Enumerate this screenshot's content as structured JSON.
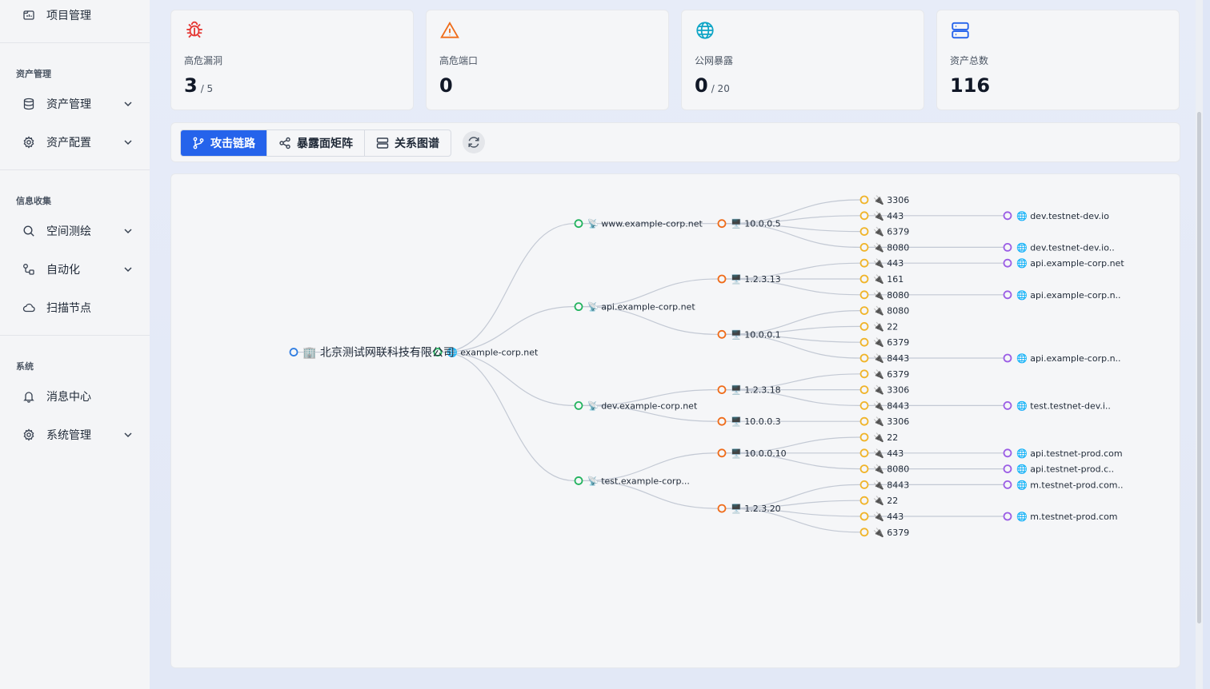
{
  "sidebar": {
    "top_item": {
      "label": "项目管理",
      "icon": "project-icon"
    },
    "sections": [
      {
        "title": "资产管理",
        "items": [
          {
            "label": "资产管理",
            "icon": "database-icon",
            "expandable": true
          },
          {
            "label": "资产配置",
            "icon": "gear-icon",
            "expandable": true
          }
        ]
      },
      {
        "title": "信息收集",
        "items": [
          {
            "label": "空间测绘",
            "icon": "search-icon",
            "expandable": true
          },
          {
            "label": "自动化",
            "icon": "workflow-icon",
            "expandable": true
          },
          {
            "label": "扫描节点",
            "icon": "cloud-icon",
            "expandable": false
          }
        ]
      },
      {
        "title": "系统",
        "items": [
          {
            "label": "消息中心",
            "icon": "bell-icon",
            "expandable": false
          },
          {
            "label": "系统管理",
            "icon": "gear-icon",
            "expandable": true
          }
        ]
      }
    ]
  },
  "stats": [
    {
      "label": "高危漏洞",
      "value": "3",
      "sub": "/ 5",
      "icon": "bug-icon",
      "color": "#e53935"
    },
    {
      "label": "高危端口",
      "value": "0",
      "sub": "",
      "icon": "warning-icon",
      "color": "#ef6c1a"
    },
    {
      "label": "公网暴露",
      "value": "0",
      "sub": "/ 20",
      "icon": "globe-icon",
      "color": "#0ea5c6"
    },
    {
      "label": "资产总数",
      "value": "116",
      "sub": "",
      "icon": "server-icon",
      "color": "#2563eb"
    }
  ],
  "toolbar": {
    "tabs": [
      {
        "label": "攻击链路",
        "icon": "branch-icon",
        "active": true
      },
      {
        "label": "暴露面矩阵",
        "icon": "share-icon",
        "active": false
      },
      {
        "label": "关系图谱",
        "icon": "server-icon",
        "active": false
      }
    ],
    "refresh_icon": "refresh-icon"
  },
  "colors": {
    "org": "#2f7de1",
    "domain": "#22b35e",
    "subdomain": "#22b35e",
    "ip": "#ef6c1a",
    "port": "#f0b429",
    "url": "#9b5de5",
    "edge": "#c3c9d4",
    "primary": "#2563eb"
  },
  "graph": {
    "root": {
      "label": "北京测试网联科技有限公司",
      "emoji": "🏢"
    },
    "domain": {
      "label": "example-corp.net",
      "emoji": "🌐"
    },
    "subdomains": [
      {
        "label": "www.example-corp.net",
        "emoji": "📡",
        "ips": [
          {
            "label": "10.0.0.5",
            "ports": [
              {
                "label": "3306"
              },
              {
                "label": "443",
                "url": "dev.testnet-dev.io"
              },
              {
                "label": "6379"
              },
              {
                "label": "8080",
                "url": "dev.testnet-dev.io.."
              }
            ]
          }
        ]
      },
      {
        "label": "api.example-corp.net",
        "emoji": "📡",
        "ips": [
          {
            "label": "1.2.3.13",
            "ports": [
              {
                "label": "443",
                "url": "api.example-corp.net"
              },
              {
                "label": "161"
              },
              {
                "label": "8080",
                "url": "api.example-corp.n.."
              }
            ]
          },
          {
            "label": "10.0.0.1",
            "ports": [
              {
                "label": "8080"
              },
              {
                "label": "22"
              },
              {
                "label": "6379"
              },
              {
                "label": "8443",
                "url": "api.example-corp.n.."
              }
            ]
          }
        ]
      },
      {
        "label": "dev.example-corp.net",
        "emoji": "📡",
        "ips": [
          {
            "label": "1.2.3.18",
            "ports": [
              {
                "label": "6379"
              },
              {
                "label": "3306"
              },
              {
                "label": "8443",
                "url": "test.testnet-dev.i.."
              }
            ]
          },
          {
            "label": "10.0.0.3",
            "ports": [
              {
                "label": "3306"
              }
            ]
          }
        ]
      },
      {
        "label": "test.example-corp...",
        "emoji": "📡",
        "ips": [
          {
            "label": "10.0.0.10",
            "ports": [
              {
                "label": "22"
              },
              {
                "label": "443",
                "url": "api.testnet-prod.com"
              },
              {
                "label": "8080",
                "url": "api.testnet-prod.c.."
              }
            ]
          },
          {
            "label": "1.2.3.20",
            "ports": [
              {
                "label": "8443",
                "url": "m.testnet-prod.com.."
              },
              {
                "label": "22"
              },
              {
                "label": "443",
                "url": "m.testnet-prod.com"
              },
              {
                "label": "6379"
              }
            ]
          }
        ]
      }
    ],
    "icons": {
      "ip": "🖥️",
      "port": "🔌",
      "url": "🌐"
    }
  }
}
